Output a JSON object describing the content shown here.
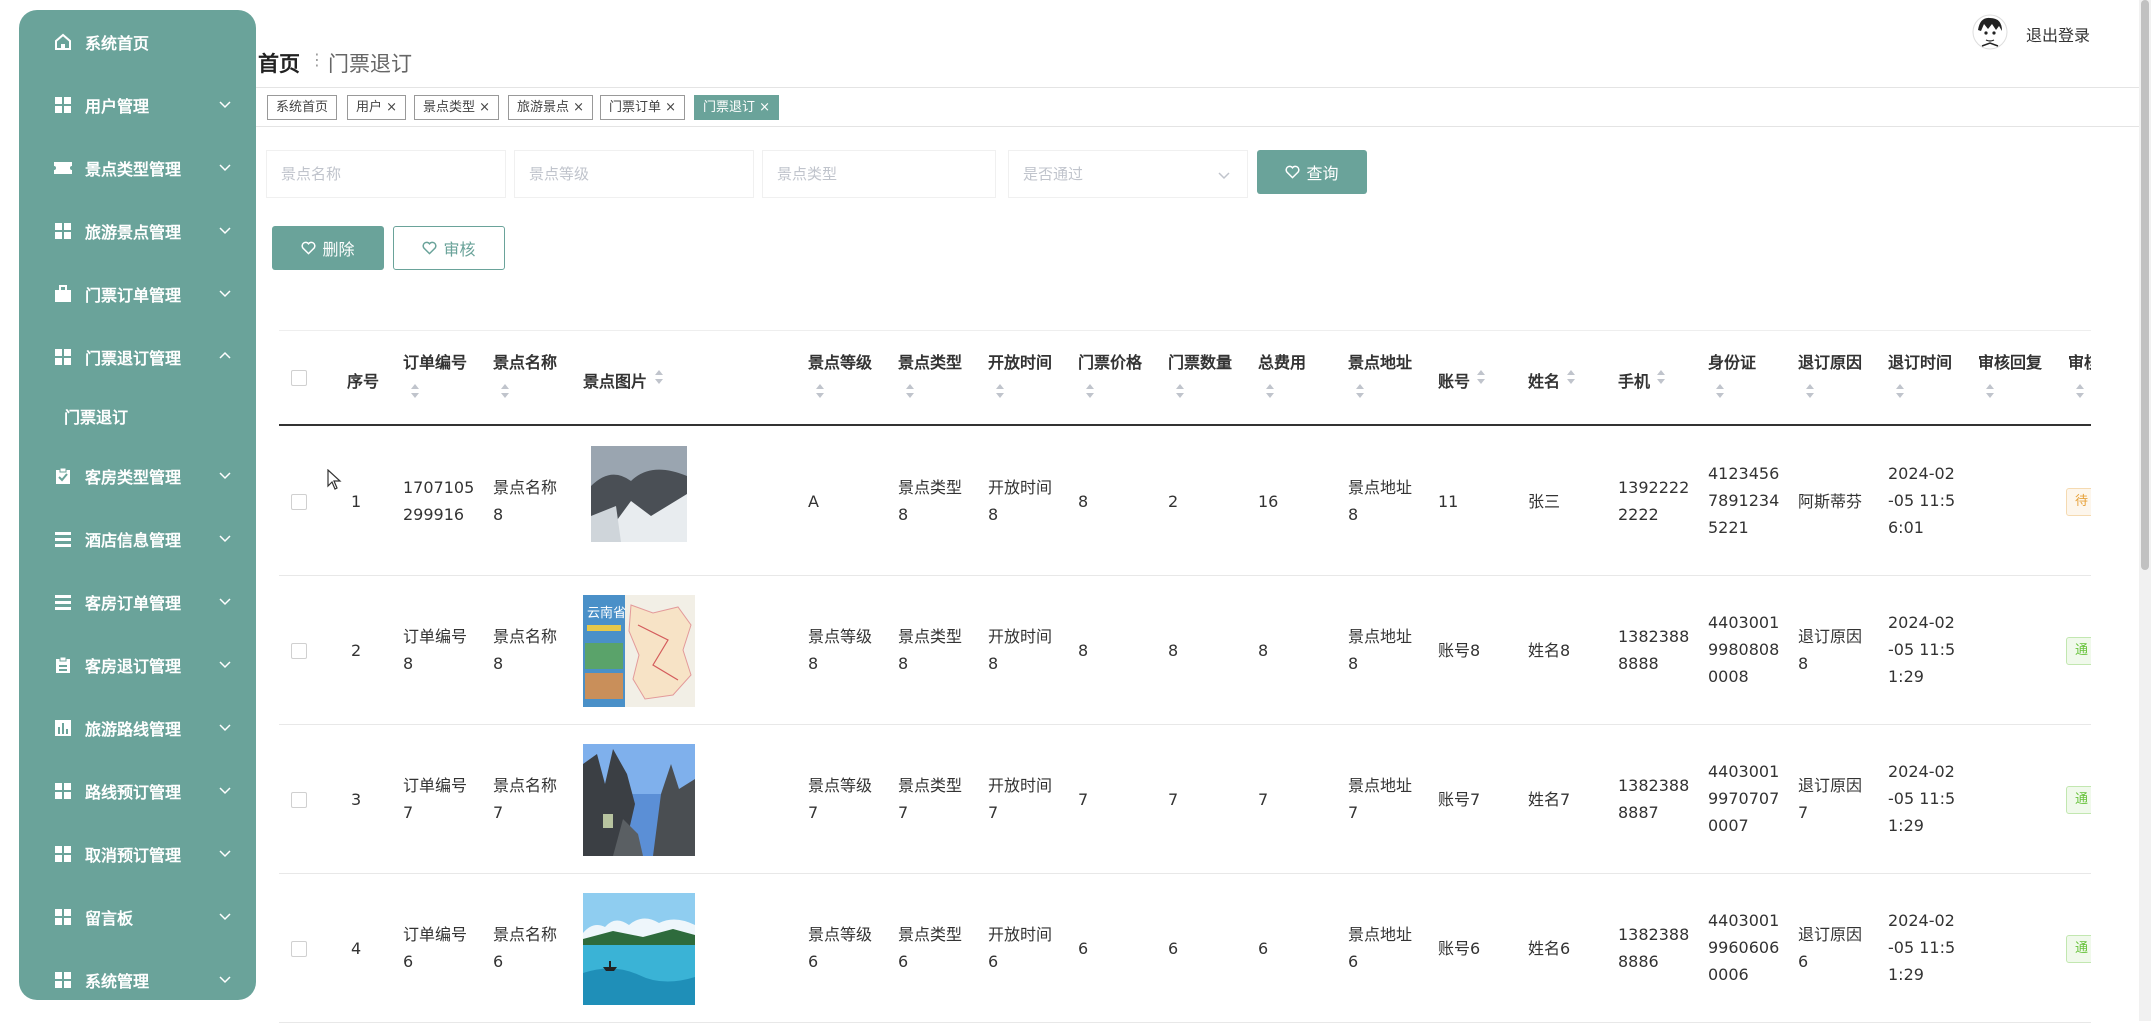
{
  "sidebar": {
    "items": [
      {
        "label": "系统首页",
        "icon": "home-icon",
        "expandable": false
      },
      {
        "label": "用户管理",
        "icon": "grid-icon",
        "expandable": true
      },
      {
        "label": "景点类型管理",
        "icon": "ticket-icon",
        "expandable": true
      },
      {
        "label": "旅游景点管理",
        "icon": "grid-icon",
        "expandable": true
      },
      {
        "label": "门票订单管理",
        "icon": "briefcase-icon",
        "expandable": true
      },
      {
        "label": "门票退订管理",
        "icon": "grid-icon",
        "expandable": true,
        "expanded": true
      },
      {
        "label": "客房类型管理",
        "icon": "clipboard-icon",
        "expandable": true
      },
      {
        "label": "酒店信息管理",
        "icon": "list-icon",
        "expandable": true
      },
      {
        "label": "客房订单管理",
        "icon": "list-icon",
        "expandable": true
      },
      {
        "label": "客房退订管理",
        "icon": "clipboard-icon",
        "expandable": true
      },
      {
        "label": "旅游路线管理",
        "icon": "chart-icon",
        "expandable": true
      },
      {
        "label": "路线预订管理",
        "icon": "grid-icon",
        "expandable": true
      },
      {
        "label": "取消预订管理",
        "icon": "grid-icon",
        "expandable": true
      },
      {
        "label": "留言板",
        "icon": "grid-icon",
        "expandable": true
      },
      {
        "label": "系统管理",
        "icon": "grid-icon",
        "expandable": true
      }
    ],
    "submenu": {
      "label": "门票退订"
    }
  },
  "header": {
    "breadcrumb_home": "首页",
    "breadcrumb_sep": "⋮",
    "breadcrumb_current": "门票退订",
    "logout": "退出登录"
  },
  "tags": [
    {
      "label": "系统首页",
      "closable": false
    },
    {
      "label": "用户",
      "closable": true
    },
    {
      "label": "景点类型",
      "closable": true
    },
    {
      "label": "旅游景点",
      "closable": true
    },
    {
      "label": "门票订单",
      "closable": true
    },
    {
      "label": "门票退订",
      "closable": true,
      "active": true
    }
  ],
  "search": {
    "name_placeholder": "景点名称",
    "level_placeholder": "景点等级",
    "type_placeholder": "景点类型",
    "approved_placeholder": "是否通过",
    "query_label": "查询"
  },
  "actions": {
    "delete_label": "删除",
    "review_label": "审核"
  },
  "table": {
    "columns": [
      "序号",
      "订单编号",
      "景点名称",
      "景点图片",
      "景点等级",
      "景点类型",
      "开放时间",
      "门票价格",
      "门票数量",
      "总费用",
      "景点地址",
      "账号",
      "姓名",
      "手机",
      "身份证",
      "退订原因",
      "退订时间",
      "审核回复",
      "审核"
    ],
    "rows": [
      {
        "idx": "1",
        "order": "1707105299916",
        "name": "景点名称8",
        "image": "snowy-mountain",
        "level": "A",
        "type": "景点类型8",
        "open": "开放时间8",
        "price": "8",
        "qty": "2",
        "total": "16",
        "addr": "景点地址8",
        "account": "11",
        "username": "张三",
        "phone": "13922222222",
        "idcard": "412345678912345221",
        "reason": "阿斯蒂芬",
        "time": "2024-02-05 11:56:01",
        "reply": "",
        "status": "待",
        "status_color": "#e6a23c"
      },
      {
        "idx": "2",
        "order": "订单编号8",
        "name": "景点名称8",
        "image": "yunnan-map",
        "level": "景点等级8",
        "type": "景点类型8",
        "open": "开放时间8",
        "price": "8",
        "qty": "8",
        "total": "8",
        "addr": "景点地址8",
        "account": "账号8",
        "username": "姓名8",
        "phone": "13823888888",
        "idcard": "440300199808080008",
        "reason": "退订原因8",
        "time": "2024-02-05 11:51:29",
        "reply": "",
        "status": "通",
        "status_color": "#67c23a"
      },
      {
        "idx": "3",
        "order": "订单编号7",
        "name": "景点名称7",
        "image": "stone-forest",
        "level": "景点等级7",
        "type": "景点类型7",
        "open": "开放时间7",
        "price": "7",
        "qty": "7",
        "total": "7",
        "addr": "景点地址7",
        "account": "账号7",
        "username": "姓名7",
        "phone": "13823888887",
        "idcard": "440300199707070007",
        "reason": "退订原因7",
        "time": "2024-02-05 11:51:29",
        "reply": "",
        "status": "通",
        "status_color": "#67c23a"
      },
      {
        "idx": "4",
        "order": "订单编号6",
        "name": "景点名称6",
        "image": "lake-boat",
        "level": "景点等级6",
        "type": "景点类型6",
        "open": "开放时间6",
        "price": "6",
        "qty": "6",
        "total": "6",
        "addr": "景点地址6",
        "account": "账号6",
        "username": "姓名6",
        "phone": "13823888886",
        "idcard": "440300199606060006",
        "reason": "退订原因6",
        "time": "2024-02-05 11:51:29",
        "reply": "",
        "status": "通",
        "status_color": "#67c23a"
      }
    ]
  },
  "colors": {
    "accent": "#6aa39a"
  }
}
